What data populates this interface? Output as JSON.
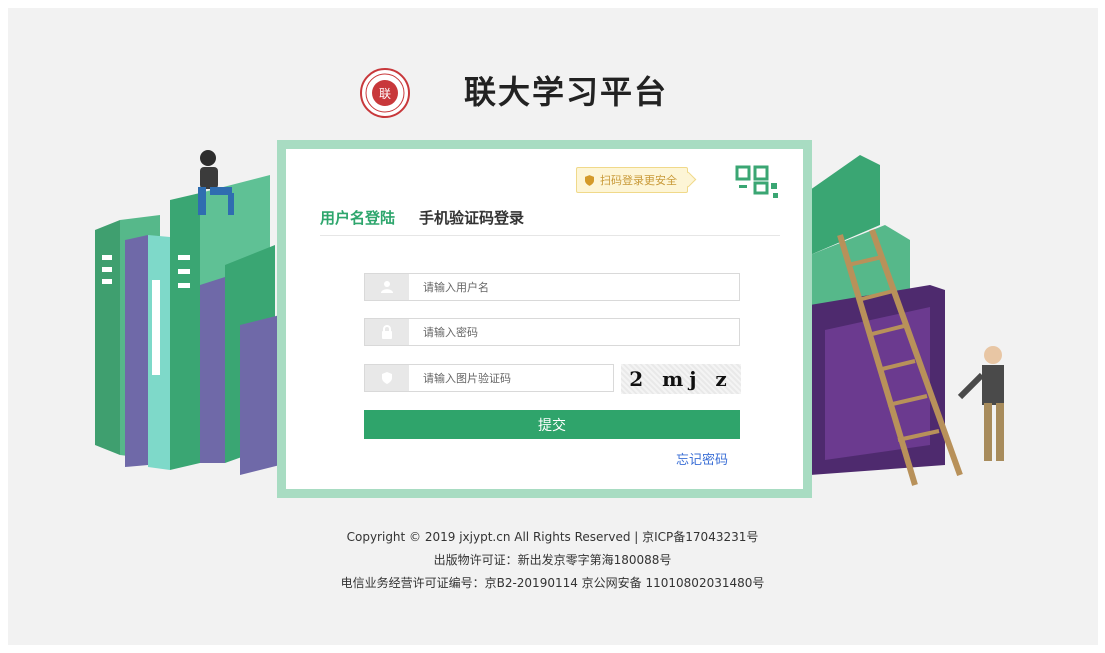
{
  "header": {
    "title": "联大学习平台",
    "logo_icon": "university-seal-icon"
  },
  "login": {
    "qr_hint": "扫码登录更安全",
    "tabs": [
      {
        "label": "用户名登陆",
        "active": true
      },
      {
        "label": "手机验证码登录",
        "active": false
      }
    ],
    "username_placeholder": "请输入用户名",
    "password_placeholder": "请输入密码",
    "captcha_placeholder": "请输入图片验证码",
    "captcha_text": "2 mj z",
    "submit_label": "提交",
    "forgot_label": "忘记密码"
  },
  "footer": {
    "line1": "Copyright © 2019 jxjypt.cn All Rights Reserved | 京ICP备17043231号",
    "line2": "出版物许可证：新出发京零字第海180088号",
    "line3": "电信业务经营许可证编号：京B2-20190114 京公网安备 11010802031480号"
  },
  "colors": {
    "accent": "#2ea66d",
    "frame": "#a8dcc2",
    "link": "#3b6fd6"
  }
}
